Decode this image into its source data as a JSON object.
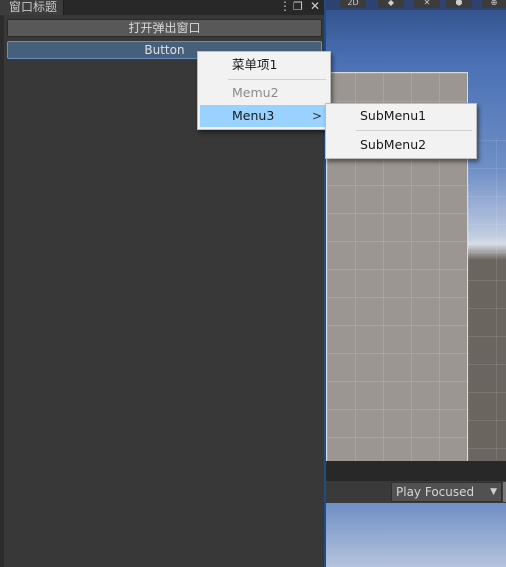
{
  "window": {
    "tab_title": "窗口标题",
    "menu_icon": "⋮",
    "maximize_icon": "❐",
    "close_icon": "✕",
    "buttons": {
      "open_popup": "打开弹出窗口",
      "button": "Button"
    }
  },
  "context_menu": {
    "items": [
      {
        "label": "菜单项1",
        "enabled": true
      },
      {
        "label": "Memu2",
        "enabled": false
      },
      {
        "label": "Menu3",
        "enabled": true,
        "submenu_arrow": ">"
      }
    ]
  },
  "submenu": {
    "items": [
      {
        "label": "SubMenu1"
      },
      {
        "label": "SubMenu2"
      }
    ]
  },
  "scene": {
    "play_mode": "Play Focused",
    "dropdown_arrow": "▼",
    "toolbar_labels": [
      "2D",
      "◆",
      "✕",
      "⬢",
      "⊕"
    ]
  },
  "colors": {
    "window_bg": "#383838",
    "menu_bg": "#f2f2f2",
    "menu_highlight": "#99d1ff",
    "button_active": "#46607c"
  }
}
